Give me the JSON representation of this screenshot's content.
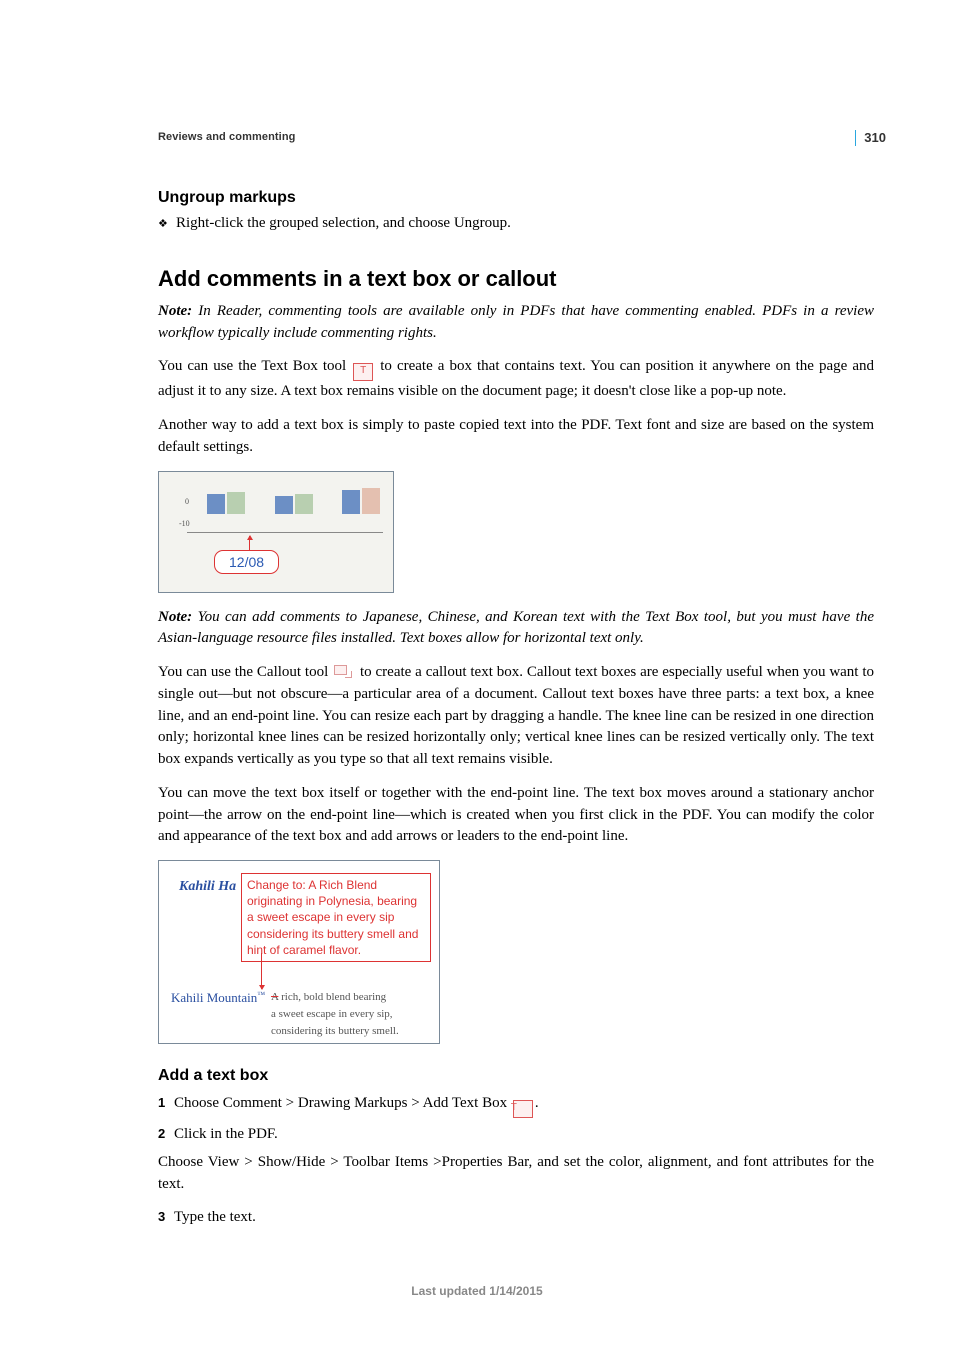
{
  "page_number": "310",
  "header_section": "Reviews and commenting",
  "ungroup": {
    "heading": "Ungroup markups",
    "bullet": "Right-click the grouped selection, and choose Ungroup."
  },
  "main": {
    "heading": "Add comments in a text box or callout",
    "note1_label": "Note:",
    "note1_text": " In Reader, commenting tools are available only in PDFs that have commenting enabled. PDFs in a review workflow typically include commenting rights.",
    "p1a": "You can use the Text Box tool ",
    "p1b": " to create a box that contains text. You can position it anywhere on the page and adjust it to any size. A text box remains visible on the document page; it doesn't close like a pop-up note.",
    "p2": "Another way to add a text box is simply to paste copied text into the PDF. Text font and size are based on the system default settings.",
    "fig1_axis0": "0",
    "fig1_axis10": "-10",
    "fig1_callout": "12/08",
    "note2_label": "Note:",
    "note2_text": " You can add comments to Japanese, Chinese, and Korean text with the Text Box tool, but you must have the Asian-language resource files installed. Text boxes allow for horizontal text only.",
    "p3a": "You can use the Callout tool ",
    "p3b": " to create a callout text box. Callout text boxes are especially useful when you want to single out—but not obscure—a particular area of a document. Callout text boxes have three parts: a text box, a knee line, and an end-point line. You can resize each part by dragging a handle. The knee line can be resized in one direction only; horizontal knee lines can be resized horizontally only; vertical knee lines can be resized vertically only. The text box expands vertically as you type so that all text remains visible.",
    "p4": "You can move the text box itself or together with the end-point line. The text box moves around a stationary anchor point—the arrow on the end-point line—which is created when you first click in the PDF. You can modify the color and appearance of the text box and add arrows or leaders to the end-point line.",
    "fig2_behind1": "Kahili Ha",
    "fig2_callout": "Change to: A Rich Blend originating in Polynesia, bearing a sweet escape in every sip considering its buttery smell and hint of caramel flavor.",
    "fig2_kahili": "Kahili Mountain",
    "fig2_tm": "™",
    "fig2_strike": "A",
    "fig2_body_line1": "rich, bold blend bearing",
    "fig2_body_line2": "a sweet escape in every sip,",
    "fig2_body_line3": "considering its buttery smell."
  },
  "addbox": {
    "heading": "Add a text box",
    "step1a": "Choose Comment > Drawing Markups > Add Text Box ",
    "step1b": ".",
    "step2": "Click in the PDF.",
    "between": "Choose View > Show/Hide > Toolbar Items >Properties Bar, and set the color, alignment, and font attributes for the text.",
    "step3": "Type the text."
  },
  "footer": "Last updated 1/14/2015"
}
